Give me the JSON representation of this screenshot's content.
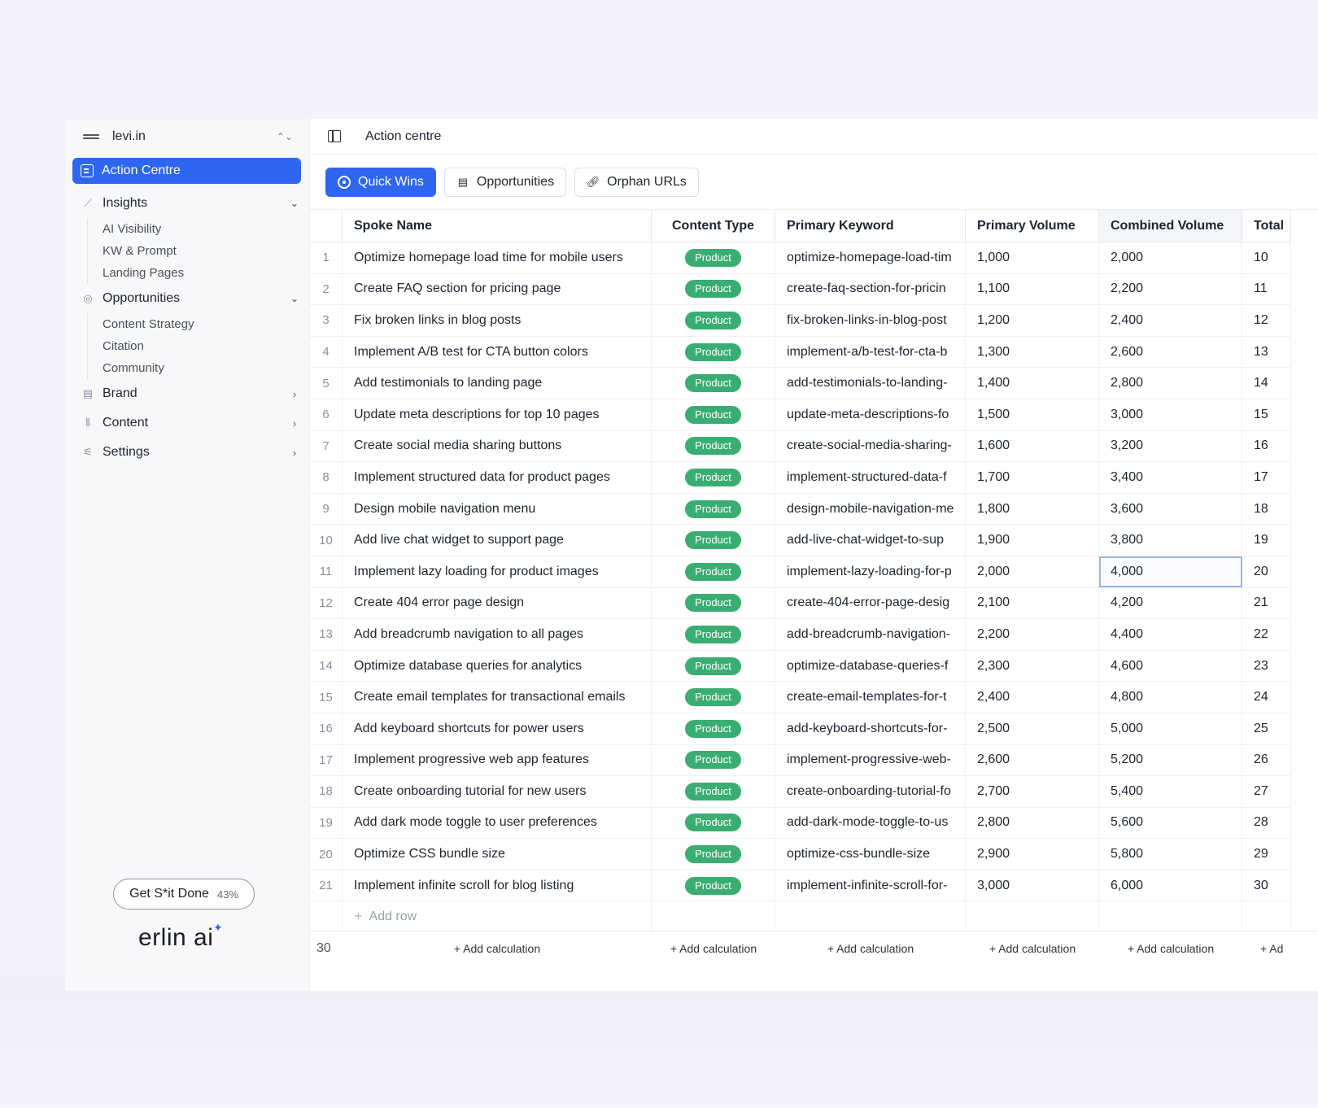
{
  "workspace": {
    "name": "levi.in"
  },
  "sidebar": {
    "active_item": "Action Centre",
    "groups": [
      {
        "label": "Insights",
        "expanded": true,
        "icon": "chart-line-icon",
        "items": [
          "AI Visibility",
          "KW & Prompt",
          "Landing Pages"
        ]
      },
      {
        "label": "Opportunities",
        "expanded": true,
        "icon": "target-icon",
        "items": [
          "Content Strategy",
          "Citation",
          "Community"
        ]
      },
      {
        "label": "Brand",
        "expanded": false,
        "icon": "document-icon",
        "items": []
      },
      {
        "label": "Content",
        "expanded": false,
        "icon": "bars-icon",
        "items": []
      },
      {
        "label": "Settings",
        "expanded": false,
        "icon": "sliders-icon",
        "items": []
      }
    ],
    "progress_pill": {
      "label": "Get S*it Done",
      "percent": "43%"
    },
    "brand": {
      "name": "erlin ai",
      "star": "✦"
    }
  },
  "header": {
    "title": "Action centre"
  },
  "tabs": [
    {
      "label": "Quick Wins",
      "active": true,
      "icon": "target-icon"
    },
    {
      "label": "Opportunities",
      "active": false,
      "icon": "document-icon"
    },
    {
      "label": "Orphan URLs",
      "active": false,
      "icon": "link-icon"
    }
  ],
  "table": {
    "columns": [
      "Spoke Name",
      "Content Type",
      "Primary Keyword",
      "Primary Volume",
      "Combined Volume",
      "Total"
    ],
    "rows": [
      {
        "num": "1",
        "spoke": "Optimize homepage load time for mobile users",
        "type": "Product",
        "keyword": "optimize-homepage-load-tim",
        "primary": "1,000",
        "combined": "2,000",
        "total": "10"
      },
      {
        "num": "2",
        "spoke": "Create FAQ section for pricing page",
        "type": "Product",
        "keyword": "create-faq-section-for-pricin",
        "primary": "1,100",
        "combined": "2,200",
        "total": "11"
      },
      {
        "num": "3",
        "spoke": "Fix broken links in blog posts",
        "type": "Product",
        "keyword": "fix-broken-links-in-blog-post",
        "primary": "1,200",
        "combined": "2,400",
        "total": "12"
      },
      {
        "num": "4",
        "spoke": "Implement A/B test for CTA button colors",
        "type": "Product",
        "keyword": "implement-a/b-test-for-cta-b",
        "primary": "1,300",
        "combined": "2,600",
        "total": "13"
      },
      {
        "num": "5",
        "spoke": "Add testimonials to landing page",
        "type": "Product",
        "keyword": "add-testimonials-to-landing-",
        "primary": "1,400",
        "combined": "2,800",
        "total": "14"
      },
      {
        "num": "6",
        "spoke": "Update meta descriptions for top 10 pages",
        "type": "Product",
        "keyword": "update-meta-descriptions-fo",
        "primary": "1,500",
        "combined": "3,000",
        "total": "15"
      },
      {
        "num": "7",
        "spoke": "Create social media sharing buttons",
        "type": "Product",
        "keyword": "create-social-media-sharing-",
        "primary": "1,600",
        "combined": "3,200",
        "total": "16"
      },
      {
        "num": "8",
        "spoke": "Implement structured data for product pages",
        "type": "Product",
        "keyword": "implement-structured-data-f",
        "primary": "1,700",
        "combined": "3,400",
        "total": "17"
      },
      {
        "num": "9",
        "spoke": "Design mobile navigation menu",
        "type": "Product",
        "keyword": "design-mobile-navigation-me",
        "primary": "1,800",
        "combined": "3,600",
        "total": "18"
      },
      {
        "num": "10",
        "spoke": "Add live chat widget to support page",
        "type": "Product",
        "keyword": "add-live-chat-widget-to-sup",
        "primary": "1,900",
        "combined": "3,800",
        "total": "19"
      },
      {
        "num": "11",
        "spoke": "Implement lazy loading for product images",
        "type": "Product",
        "keyword": "implement-lazy-loading-for-p",
        "primary": "2,000",
        "combined": "4,000",
        "total": "20"
      },
      {
        "num": "12",
        "spoke": "Create 404 error page design",
        "type": "Product",
        "keyword": "create-404-error-page-desig",
        "primary": "2,100",
        "combined": "4,200",
        "total": "21"
      },
      {
        "num": "13",
        "spoke": "Add breadcrumb navigation to all pages",
        "type": "Product",
        "keyword": "add-breadcrumb-navigation-",
        "primary": "2,200",
        "combined": "4,400",
        "total": "22"
      },
      {
        "num": "14",
        "spoke": "Optimize database queries for analytics",
        "type": "Product",
        "keyword": "optimize-database-queries-f",
        "primary": "2,300",
        "combined": "4,600",
        "total": "23"
      },
      {
        "num": "15",
        "spoke": "Create email templates for transactional emails",
        "type": "Product",
        "keyword": "create-email-templates-for-t",
        "primary": "2,400",
        "combined": "4,800",
        "total": "24"
      },
      {
        "num": "16",
        "spoke": "Add keyboard shortcuts for power users",
        "type": "Product",
        "keyword": "add-keyboard-shortcuts-for-",
        "primary": "2,500",
        "combined": "5,000",
        "total": "25"
      },
      {
        "num": "17",
        "spoke": "Implement progressive web app features",
        "type": "Product",
        "keyword": "implement-progressive-web-",
        "primary": "2,600",
        "combined": "5,200",
        "total": "26"
      },
      {
        "num": "18",
        "spoke": "Create onboarding tutorial for new users",
        "type": "Product",
        "keyword": "create-onboarding-tutorial-fo",
        "primary": "2,700",
        "combined": "5,400",
        "total": "27"
      },
      {
        "num": "19",
        "spoke": "Add dark mode toggle to user preferences",
        "type": "Product",
        "keyword": "add-dark-mode-toggle-to-us",
        "primary": "2,800",
        "combined": "5,600",
        "total": "28"
      },
      {
        "num": "20",
        "spoke": "Optimize CSS bundle size",
        "type": "Product",
        "keyword": "optimize-css-bundle-size",
        "primary": "2,900",
        "combined": "5,800",
        "total": "29"
      },
      {
        "num": "21",
        "spoke": "Implement infinite scroll for blog listing",
        "type": "Product",
        "keyword": "implement-infinite-scroll-for-",
        "primary": "3,000",
        "combined": "6,000",
        "total": "30"
      }
    ],
    "selected_cell": {
      "row": 11,
      "column": "Combined Volume"
    },
    "add_row_label": "Add row",
    "footer": {
      "count": "30",
      "add_calc_labels": [
        "+ Add calculation",
        "+ Add calculation",
        "+ Add calculation",
        "+ Add calculation",
        "+ Add calculation",
        "+ Ad"
      ]
    }
  },
  "colors": {
    "accent": "#2e66f0",
    "badge_green": "#3aae72",
    "sidebar_bg": "#f8f8fa"
  }
}
